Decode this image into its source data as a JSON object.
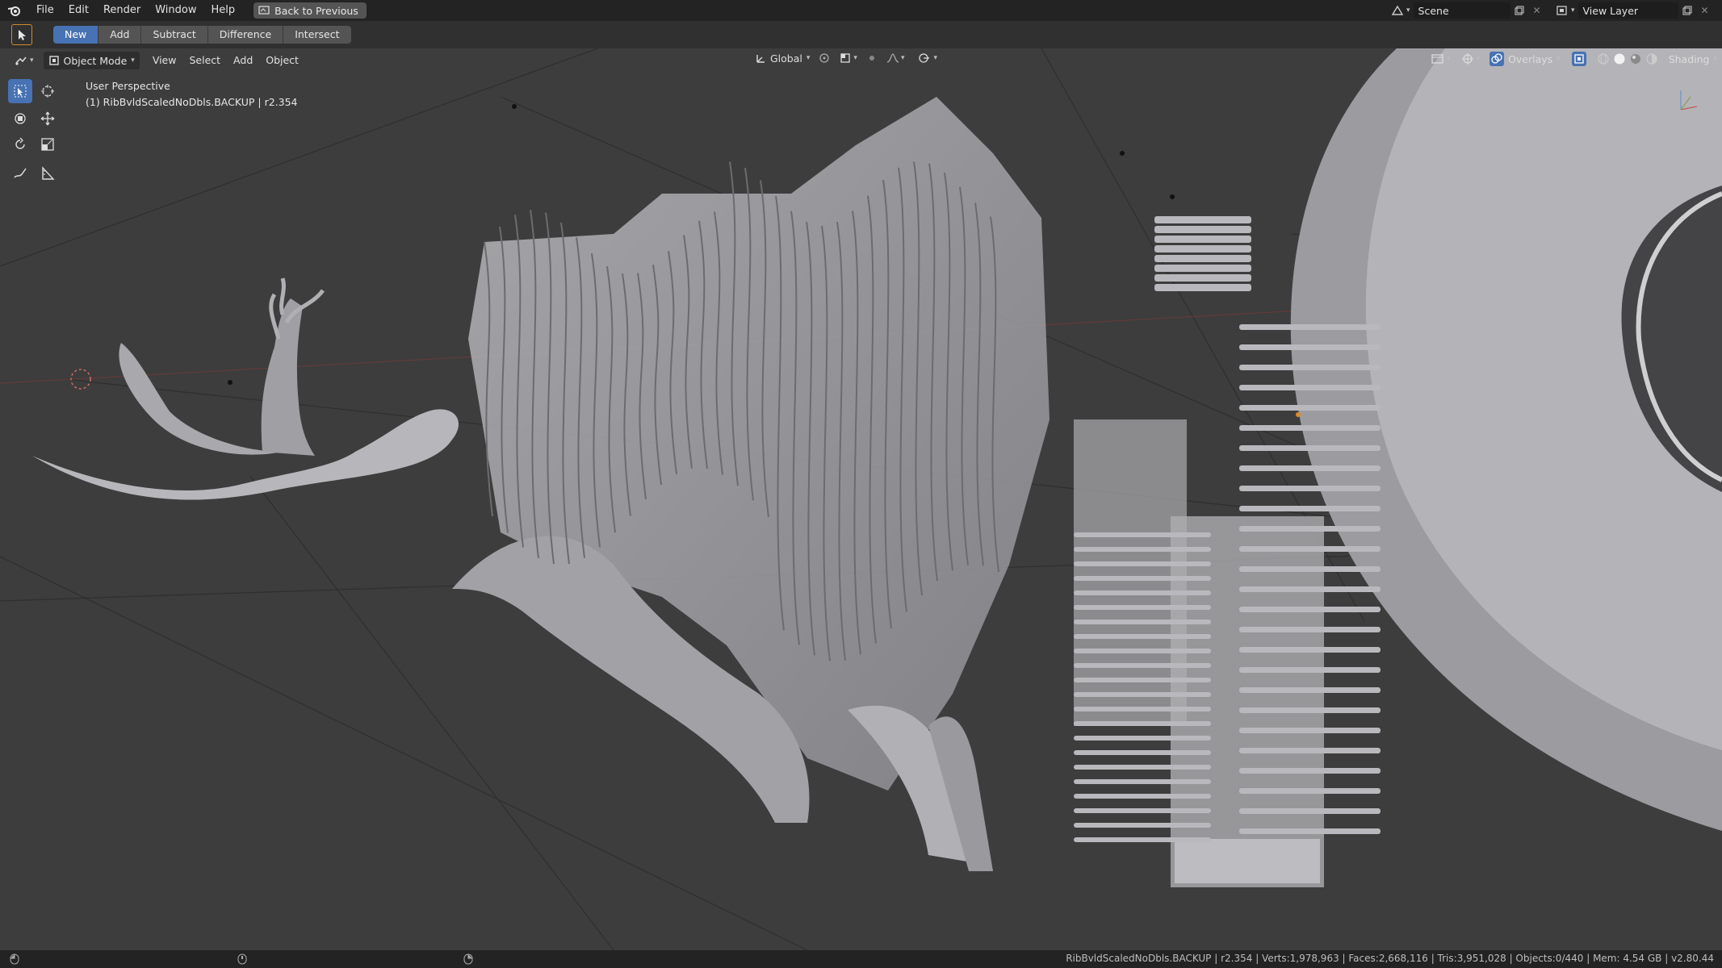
{
  "topbar": {
    "menu": [
      "File",
      "Edit",
      "Render",
      "Window",
      "Help"
    ],
    "back_label": "Back to Previous",
    "scene_label": "Scene",
    "view_layer_label": "View Layer"
  },
  "boolean_bar": {
    "operations": [
      "New",
      "Add",
      "Subtract",
      "Difference",
      "Intersect"
    ],
    "active": "New"
  },
  "viewport_header": {
    "mode": "Object Mode",
    "menus": [
      "View",
      "Select",
      "Add",
      "Object"
    ],
    "orientation": "Global",
    "overlays_label": "Overlays",
    "shading_label": "Shading"
  },
  "viewport_info": {
    "perspective": "User Perspective",
    "active_object": "(1) RibBvldScaledNoDbls.BACKUP | r2.354"
  },
  "statusbar": {
    "text": "RibBvldScaledNoDbls.BACKUP | r2.354 | Verts:1,978,963 | Faces:2,668,116 | Tris:3,951,028 | Objects:0/440 | Mem: 4.54 GB | v2.80.44"
  },
  "colors": {
    "accent": "#4772b3",
    "active_tool_border": "#d08a2a",
    "mesh_fill": "#a9a9ad",
    "background": "#3d3d3d"
  }
}
